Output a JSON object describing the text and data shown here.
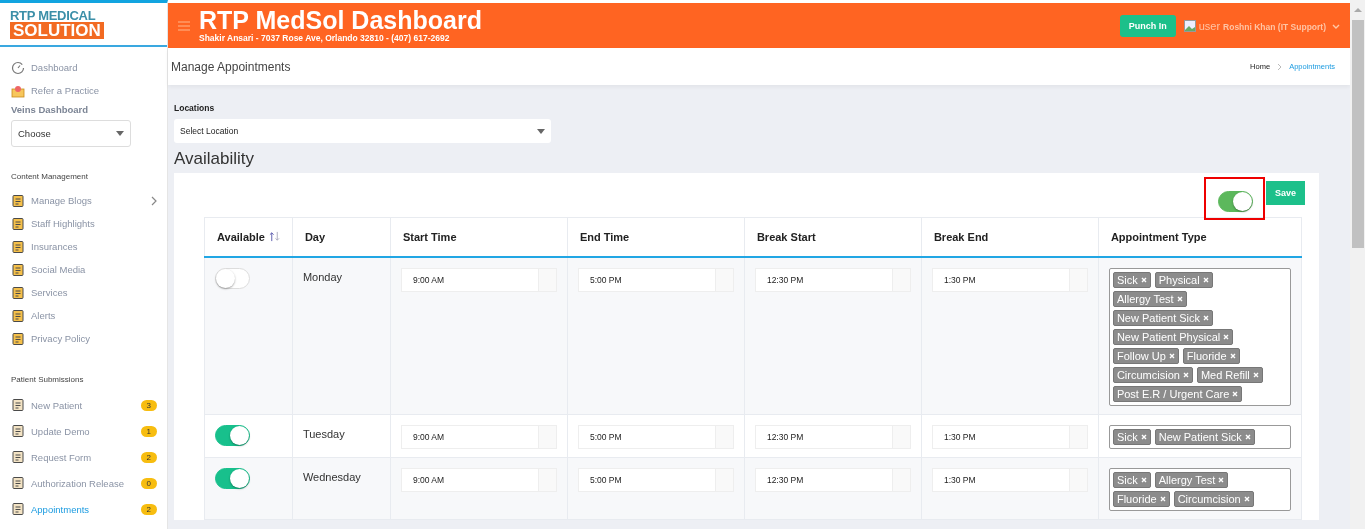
{
  "header": {
    "logo": {
      "line1": "RTP MEDICAL",
      "line2": "SOLUTION"
    },
    "title": "RTP MedSol Dashboard",
    "subtitle": "Shakir Ansari - 7037 Rose Ave, Orlando 32810 - (407) 617-2692",
    "punch_in_button": "Punch In",
    "user": {
      "image_alt": "user",
      "name": "Roshni Khan (IT Support)"
    }
  },
  "sidebar": {
    "top_items": [
      {
        "label": "Dashboard",
        "kind": "gauge"
      },
      {
        "label": "Refer a Practice",
        "kind": "envelope"
      }
    ],
    "veins_dashboard": {
      "label": "Veins Dashboard",
      "value": "Choose"
    },
    "sections": [
      {
        "title": "Content Management",
        "items": [
          {
            "label": "Manage Blogs",
            "expanded": false,
            "selected": false
          },
          {
            "label": "Staff Highlights",
            "selected": false
          },
          {
            "label": "Insurances",
            "selected": false
          },
          {
            "label": "Social Media",
            "selected": false
          },
          {
            "label": "Services",
            "selected": false
          },
          {
            "label": "Alerts",
            "selected": false
          },
          {
            "label": "Privacy Policy",
            "selected": false
          }
        ]
      },
      {
        "title": "Patient Submissions",
        "items": [
          {
            "label": "New Patient",
            "badge": "3",
            "selected": false
          },
          {
            "label": "Update Demo",
            "badge": "1",
            "selected": false
          },
          {
            "label": "Request Form",
            "badge": "2",
            "selected": false
          },
          {
            "label": "Authorization Release",
            "badge": "0",
            "selected": false
          },
          {
            "label": "Appointments",
            "badge": "2",
            "selected": true
          }
        ]
      }
    ]
  },
  "page_title": "Manage Appointments",
  "breadcrumb": [
    {
      "label": "Home",
      "selected": false
    },
    {
      "label": "Appointments",
      "selected": true
    }
  ],
  "locations": {
    "label": "Locations",
    "value": "Select Location"
  },
  "availability": {
    "title": "Availability",
    "master_toggle": {
      "on": true
    },
    "save_button": "Save",
    "columns": [
      "Available",
      "Day",
      "Start Time",
      "End Time",
      "Break Start",
      "Break End",
      "Appointment Type"
    ],
    "rows": [
      {
        "available": false,
        "day": "Monday",
        "start": "9:00 AM",
        "end": "5:00 PM",
        "break_start": "12:30 PM",
        "break_end": "1:30 PM",
        "types": [
          "Sick",
          "Physical",
          "Allergy Test",
          "New Patient Sick",
          "New Patient Physical",
          "Follow Up",
          "Fluoride",
          "Circumcision",
          "Med Refill",
          "Post E.R / Urgent Care"
        ]
      },
      {
        "available": true,
        "day": "Tuesday",
        "start": "9:00 AM",
        "end": "5:00 PM",
        "break_start": "12:30 PM",
        "break_end": "1:30 PM",
        "types": [
          "Sick",
          "New Patient Sick"
        ]
      },
      {
        "available": true,
        "day": "Wednesday",
        "start": "9:00 AM",
        "end": "5:00 PM",
        "break_start": "12:30 PM",
        "break_end": "1:30 PM",
        "types": [
          "Sick",
          "Allergy Test",
          "Fluoride",
          "Circumcision"
        ]
      }
    ]
  }
}
